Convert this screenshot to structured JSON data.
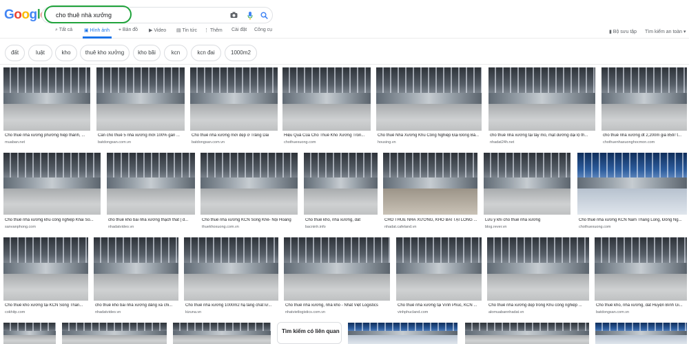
{
  "logo": {
    "text": "Google",
    "letters": [
      {
        "ch": "G",
        "color": "#4285f4"
      },
      {
        "ch": "o",
        "color": "#ea4335"
      },
      {
        "ch": "o",
        "color": "#fbbc05"
      },
      {
        "ch": "g",
        "color": "#4285f4"
      },
      {
        "ch": "l",
        "color": "#34a853"
      },
      {
        "ch": "e",
        "color": "#ea4335"
      }
    ]
  },
  "search": {
    "query": "cho thuê nhà xưởng",
    "highlight_color": "#1fa33a",
    "icons": [
      "camera-icon",
      "mic-icon",
      "search-icon"
    ]
  },
  "tabs": [
    {
      "label": "Tất cả",
      "icon": "search-icon",
      "active": false
    },
    {
      "label": "Hình ảnh",
      "icon": "image-icon",
      "active": true
    },
    {
      "label": "Bản đồ",
      "icon": "pin-icon",
      "active": false
    },
    {
      "label": "Video",
      "icon": "video-icon",
      "active": false
    },
    {
      "label": "Tin tức",
      "icon": "news-icon",
      "active": false
    },
    {
      "label": "Thêm",
      "icon": "more-icon",
      "active": false
    },
    {
      "label": "Cài đặt",
      "icon": "",
      "active": false
    },
    {
      "label": "Công cụ",
      "icon": "",
      "active": false
    }
  ],
  "right_tools": {
    "collections": "Bộ sưu tập",
    "safe_search": "Tìm kiếm an toàn"
  },
  "chips": [
    "đất",
    "luật",
    "kho",
    "thuê kho xưởng",
    "kho bãi",
    "kcn",
    "kcn đai",
    "1000m2"
  ],
  "images": [
    {
      "caption": "Cho thuê nhà xưởng phường hiệp thành, ...",
      "source": "muaban.net"
    },
    {
      "caption": "Cần cho thuê 5 nhà xưởng mới 100% gần ...",
      "source": "batdongsan.com.vn"
    },
    {
      "caption": "Cho thuê nhà xưởng mới đẹp ở Trảng Dài",
      "source": "batdongsan.com.vn"
    },
    {
      "caption": "Hiệu Quả Của Cho Thuê Kho Xưởng Tron...",
      "source": "chothuexuong.com"
    },
    {
      "caption": "Cho thuê Nhà Xưởng Khu Công Nghiệp Đại Đồng Bả...",
      "source": "housing.vn"
    },
    {
      "caption": "cho thuê nhà xưởng tại tây mỗ, mặt đường đại lộ th...",
      "source": "nhadat24h.net"
    },
    {
      "caption": "cho thuê nhà xưởng dt 2,200m giá 85tr/ t...",
      "source": "chothuenhaxuonghocmon.com"
    },
    {
      "caption": "Cho thuê nhà xưởng khu công nghiệp Khai So...",
      "source": "sanvanphong.com"
    },
    {
      "caption": "cho thuê kho bãi nhà xưởng thạch thất | đ...",
      "source": "nhadatvideo.vn"
    },
    {
      "caption": "Cho thuê nhà xưởng KCN Song Khê- Nội Hoàng",
      "source": "thuekhoxuong.com.vn"
    },
    {
      "caption": "Cho thuê kho, nhà xưởng, đất",
      "source": "bacninh.info"
    },
    {
      "caption": "CHO THUÊ NHÀ XƯỞNG, KHO BÃI TẠI LONG ...",
      "source": "nhadat.cafeland.vn"
    },
    {
      "caption": "Lưu ý khi cho thuê nhà xưởng",
      "source": "blog.rever.vn"
    },
    {
      "caption": "Cho thuê nhà xưởng KCN Nam Thăng Long, Đông Ng...",
      "source": "chothuexuong.com"
    },
    {
      "caption": "Cho thuê kho xưởng tại KCN Sóng Thần...",
      "source": "cokhitp.com"
    },
    {
      "caption": "cho thuê kho bãi nhà xưởng đảng xá chi...",
      "source": "nhadatvideo.vn"
    },
    {
      "caption": "Cho thuê nhà xưởng 1000m2 hạ tầng chất lư...",
      "source": "kizuna.vn"
    },
    {
      "caption": "Cho thuê nhà xưởng, nhà kho - Nhất Việt Logistics",
      "source": "nhatvietlogistics.com.vn"
    },
    {
      "caption": "Cho thuê nhà xưởng tại Vĩnh Phúc, KCN ...",
      "source": "vinhphucland.com"
    },
    {
      "caption": "Cho thuê nhà xưởng đẹp trong Khu công nghiệp ...",
      "source": "alomuabannhadat.vn"
    },
    {
      "caption": "Cho thuê kho, nhà xưởng, đất Huyện Bình Gi...",
      "source": "batdongsan.com.vn"
    }
  ],
  "related": {
    "label": "Tìm kiếm có liên quan"
  }
}
